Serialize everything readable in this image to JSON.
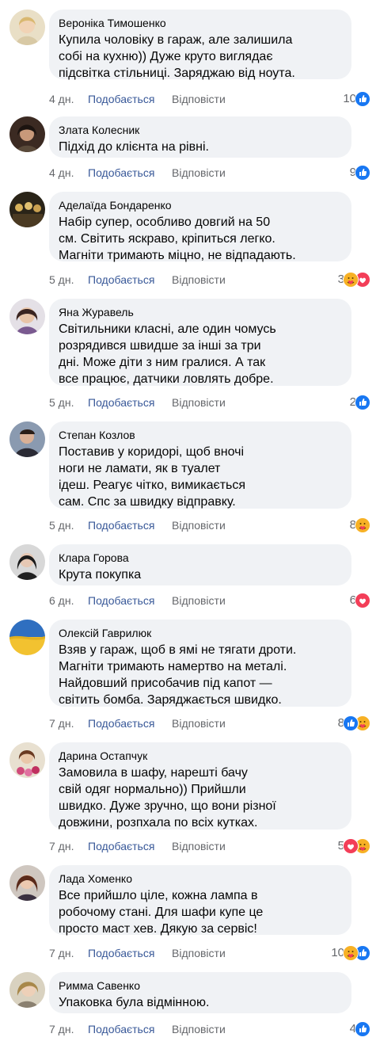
{
  "colors": {
    "bubble": "#f0f2f5",
    "like_link": "#385898",
    "meta": "#65676b",
    "like_icon": "#1877f2",
    "love_icon": "#f33e58",
    "care_icon": "#f7b125"
  },
  "labels": {
    "like": "Подобається",
    "reply": "Відповісти"
  },
  "comments": [
    {
      "author": "Вероніка Тимошенко",
      "text": "Купила чоловіку в гараж, але залишила\nсобі на кухню)) Дуже круто виглядає\nпідсвітка стільниці. Заряджаю від ноута.",
      "time": "4 дн.",
      "count": "10",
      "reactions": [
        "like-icon"
      ]
    },
    {
      "author": "Злата Колесник",
      "text": "Підхід до клієнта на рівні.",
      "time": "4 дн.",
      "count": "9",
      "reactions": [
        "like-icon"
      ]
    },
    {
      "author": "Аделаїда Бондаренко",
      "text": "Набір супер, особливо довгий на 50\nсм. Світить яскраво, кріпиться легко.\nМагніти тримають міцно, не відпадають.",
      "time": "5 дн.",
      "count": "3",
      "reactions": [
        "care-icon",
        "love-icon"
      ]
    },
    {
      "author": "Яна Журавель",
      "text": "Світильники класні, але один чомусь\nрозрядився швидше за інші за три\nдні. Може діти з ним гралися. А так\nвсе працює, датчики ловлять добре.",
      "time": "5 дн.",
      "count": "2",
      "reactions": [
        "like-icon"
      ]
    },
    {
      "author": "Степан Козлов",
      "text": "Поставив у коридорі, щоб вночі\nноги не ламати, як в туалет\nідеш. Реагує чітко, вимикається\nсам. Спс за швидку відправку.",
      "time": "5 дн.",
      "count": "8",
      "reactions": [
        "care-icon"
      ]
    },
    {
      "author": "Клара Горова",
      "text": "Крута покупка",
      "time": "6 дн.",
      "count": "6",
      "reactions": [
        "love-icon"
      ]
    },
    {
      "author": "Олексій Гаврилюк",
      "text": "Взяв у гараж, щоб в ямі не тягати дроти.\nМагніти тримають намертво на металі.\nНайдовший присобачив під капот —\nсвітить бомба. Заряджається швидко.",
      "time": "7 дн.",
      "count": "8",
      "reactions": [
        "like-icon",
        "care-icon"
      ]
    },
    {
      "author": "Дарина Остапчук",
      "text": "Замовила в шафу, нарешті бачу\nсвій одяг нормально)) Прийшли\nшвидко. Дуже зручно, що вони різної\nдовжини, розпхала по всіх кутках.",
      "time": "7 дн.",
      "count": "5",
      "reactions": [
        "love-icon",
        "care-icon"
      ]
    },
    {
      "author": "Лада Хоменко",
      "text": "Все прийшло ціле, кожна лампа в\nробочому стані. Для шафи купе це\nпросто маст хев. Дякую за сервіс!",
      "time": "7 дн.",
      "count": "10",
      "reactions": [
        "care-icon",
        "like-icon"
      ]
    },
    {
      "author": "Римма Савенко",
      "text": "Упаковка була відмінною.",
      "time": "7 дн.",
      "count": "4",
      "reactions": [
        "like-icon"
      ]
    }
  ]
}
